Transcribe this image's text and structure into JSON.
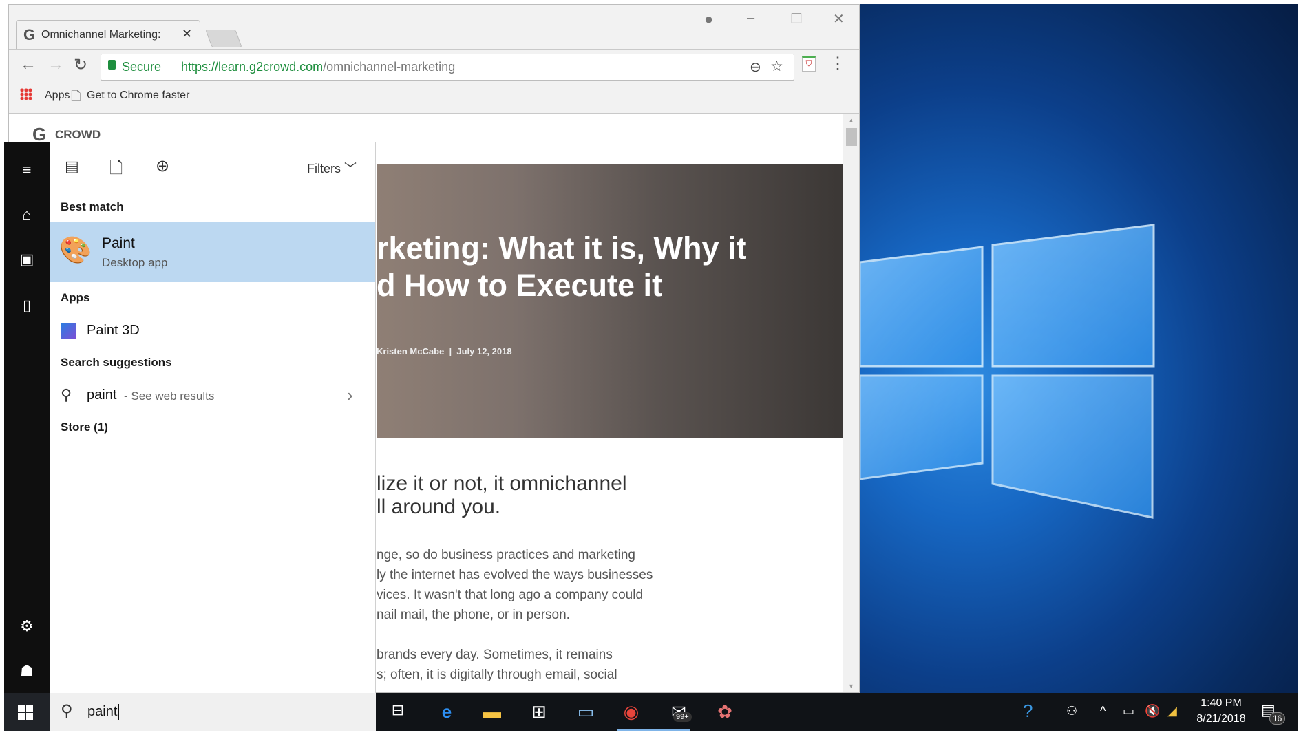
{
  "browser": {
    "tab": {
      "title": "Omnichannel Marketing:",
      "favicon": "g2-icon"
    },
    "window_controls": [
      "profile-icon",
      "minimize-icon",
      "maximize-icon",
      "close-icon"
    ],
    "address": {
      "secure_label": "Secure",
      "url_host": "https://learn.g2crowd.com",
      "url_path": "/omnichannel-marketing"
    },
    "bookmarks": [
      {
        "label": "Apps",
        "icon": "apps-grid-icon"
      },
      {
        "label": "Get to Chrome faster",
        "icon": "page-icon"
      }
    ],
    "page": {
      "logo": "G2 CROWD",
      "logo_text": "CROWD",
      "hero_title_lines": [
        "rketing: What it is, Why it",
        "d How to Execute it"
      ],
      "byline": "Kristen McCabe  |  July 12, 2018",
      "subhead_lines": [
        "lize it or not, it omnichannel",
        "ll around you."
      ],
      "paragraph1": [
        "nge, so do business practices and marketing",
        "ly the internet has evolved the ways businesses",
        "vices. It wasn't that long ago a company could",
        "nail mail, the phone, or in person."
      ],
      "paragraph2": [
        "brands every day. Sometimes, it remains",
        "s; often, it is digitally through email, social"
      ]
    }
  },
  "start": {
    "rail": [
      "hamburger-icon",
      "home-icon",
      "documents-icon",
      "device-icon",
      "settings-icon",
      "user-icon"
    ],
    "filters_label": "Filters",
    "best_match_label": "Best match",
    "best_match": {
      "name": "Paint",
      "type": "Desktop app"
    },
    "apps_label": "Apps",
    "apps": [
      {
        "name": "Paint 3D"
      }
    ],
    "suggestions_label": "Search suggestions",
    "suggestion": {
      "query": "paint",
      "hint": "- See web results"
    },
    "store_label": "Store (1)",
    "search_value": "paint"
  },
  "taskbar": {
    "apps": [
      "task-view-icon",
      "edge-icon",
      "file-explorer-icon",
      "store-icon",
      "remote-desktop-icon",
      "chrome-icon",
      "mail-icon",
      "app-icon"
    ],
    "mail_badge": "99+",
    "time": "1:40 PM",
    "date": "8/21/2018",
    "notifications_count": "16",
    "colors": {
      "highlight": "#bcd8f1",
      "accent": "#0078d7"
    }
  }
}
